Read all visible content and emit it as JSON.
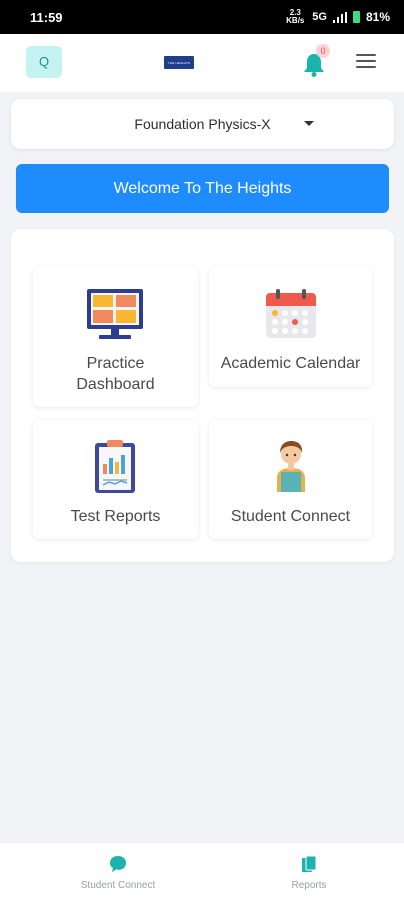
{
  "status_bar": {
    "time": "11:59",
    "signal_small": "2.3 KB/s",
    "network": "5G",
    "battery": "81%"
  },
  "header": {
    "avatar_initial": "Q",
    "notification_count": "0"
  },
  "course_selector": {
    "selected": "Foundation Physics-X"
  },
  "banner": {
    "text": "Welcome To The Heights"
  },
  "tiles": [
    {
      "label": "Practice\nDashboard",
      "icon": "monitor-dashboard-icon"
    },
    {
      "label": "Academic Calendar",
      "icon": "calendar-icon"
    },
    {
      "label": "Test Reports",
      "icon": "clipboard-report-icon"
    },
    {
      "label": "Student Connect",
      "icon": "student-icon"
    }
  ],
  "bottom_nav": {
    "items": [
      {
        "label": "Student Connect",
        "icon": "chat-bubble-icon"
      },
      {
        "label": "Reports",
        "icon": "documents-icon"
      }
    ]
  },
  "colors": {
    "accent": "#1e8cff",
    "teal": "#1cb3ad",
    "background": "#f2f3f7"
  }
}
